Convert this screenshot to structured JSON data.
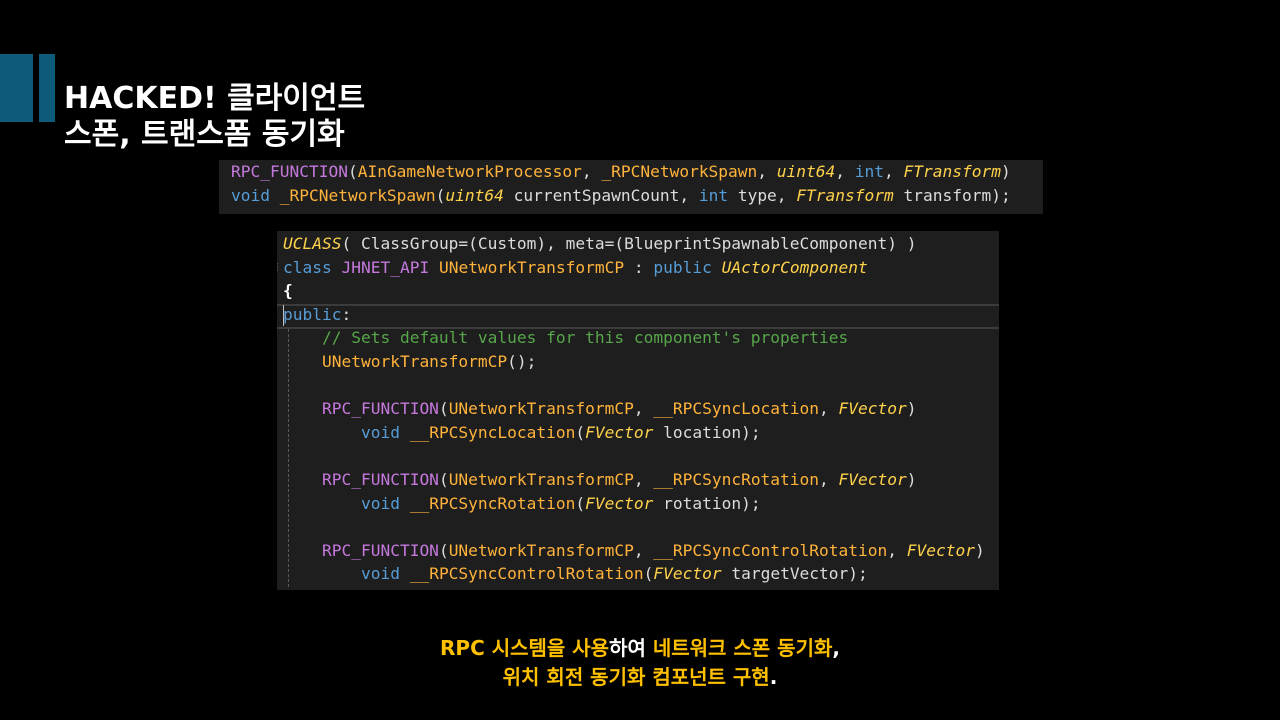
{
  "slide": {
    "title_line_1": "HACKED! 클라이언트",
    "title_line_2": "스폰, 트랜스폼 동기화"
  },
  "code_rpc": {
    "lines": [
      [
        {
          "t": "RPC_FUNCTION",
          "c": "macro"
        },
        {
          "t": "(",
          "c": "plain"
        },
        {
          "t": "AInGameNetworkProcessor",
          "c": "fn"
        },
        {
          "t": ", ",
          "c": "plain"
        },
        {
          "t": "_RPCNetworkSpawn",
          "c": "fn"
        },
        {
          "t": ", ",
          "c": "plain"
        },
        {
          "t": "uint64",
          "c": "type"
        },
        {
          "t": ", ",
          "c": "plain"
        },
        {
          "t": "int",
          "c": "kw"
        },
        {
          "t": ", ",
          "c": "plain"
        },
        {
          "t": "FTransform",
          "c": "type"
        },
        {
          "t": ")",
          "c": "plain"
        }
      ],
      [
        {
          "t": "void",
          "c": "kw"
        },
        {
          "t": " ",
          "c": "plain"
        },
        {
          "t": "_RPCNetworkSpawn",
          "c": "fn"
        },
        {
          "t": "(",
          "c": "plain"
        },
        {
          "t": "uint64",
          "c": "type"
        },
        {
          "t": " currentSpawnCount, ",
          "c": "plain"
        },
        {
          "t": "int",
          "c": "kw"
        },
        {
          "t": " type, ",
          "c": "plain"
        },
        {
          "t": "FTransform",
          "c": "type"
        },
        {
          "t": " transform);",
          "c": "plain"
        }
      ]
    ]
  },
  "code_class": {
    "lines": [
      [
        {
          "t": "UCLASS",
          "c": "type"
        },
        {
          "t": "( ClassGroup=(Custom), meta=(BlueprintSpawnableComponent) )",
          "c": "plain"
        }
      ],
      [
        {
          "t": "class",
          "c": "kw"
        },
        {
          "t": " ",
          "c": "plain"
        },
        {
          "t": "JHNET_API",
          "c": "macro"
        },
        {
          "t": " ",
          "c": "plain"
        },
        {
          "t": "UNetworkTransformCP",
          "c": "fn"
        },
        {
          "t": " : ",
          "c": "plain"
        },
        {
          "t": "public",
          "c": "kw"
        },
        {
          "t": " ",
          "c": "plain"
        },
        {
          "t": "UActorComponent",
          "c": "type"
        }
      ],
      [
        {
          "t": "{",
          "c": "bracket"
        }
      ],
      [
        {
          "t": "public",
          "c": "kw"
        },
        {
          "t": ":",
          "c": "plain"
        }
      ],
      [
        {
          "t": "    ",
          "c": "plain"
        },
        {
          "t": "// Sets default values for this component's properties",
          "c": "comment"
        }
      ],
      [
        {
          "t": "    ",
          "c": "plain"
        },
        {
          "t": "UNetworkTransformCP",
          "c": "fn"
        },
        {
          "t": "();",
          "c": "plain"
        }
      ],
      [],
      [
        {
          "t": "    ",
          "c": "plain"
        },
        {
          "t": "RPC_FUNCTION",
          "c": "macro"
        },
        {
          "t": "(",
          "c": "plain"
        },
        {
          "t": "UNetworkTransformCP",
          "c": "fn"
        },
        {
          "t": ", ",
          "c": "plain"
        },
        {
          "t": "__RPCSyncLocation",
          "c": "fn"
        },
        {
          "t": ", ",
          "c": "plain"
        },
        {
          "t": "FVector",
          "c": "type"
        },
        {
          "t": ")",
          "c": "plain"
        }
      ],
      [
        {
          "t": "        ",
          "c": "plain"
        },
        {
          "t": "void",
          "c": "kw"
        },
        {
          "t": " ",
          "c": "plain"
        },
        {
          "t": "__RPCSyncLocation",
          "c": "fn"
        },
        {
          "t": "(",
          "c": "plain"
        },
        {
          "t": "FVector",
          "c": "type"
        },
        {
          "t": " location);",
          "c": "plain"
        }
      ],
      [],
      [
        {
          "t": "    ",
          "c": "plain"
        },
        {
          "t": "RPC_FUNCTION",
          "c": "macro"
        },
        {
          "t": "(",
          "c": "plain"
        },
        {
          "t": "UNetworkTransformCP",
          "c": "fn"
        },
        {
          "t": ", ",
          "c": "plain"
        },
        {
          "t": "__RPCSyncRotation",
          "c": "fn"
        },
        {
          "t": ", ",
          "c": "plain"
        },
        {
          "t": "FVector",
          "c": "type"
        },
        {
          "t": ")",
          "c": "plain"
        }
      ],
      [
        {
          "t": "        ",
          "c": "plain"
        },
        {
          "t": "void",
          "c": "kw"
        },
        {
          "t": " ",
          "c": "plain"
        },
        {
          "t": "__RPCSyncRotation",
          "c": "fn"
        },
        {
          "t": "(",
          "c": "plain"
        },
        {
          "t": "FVector",
          "c": "type"
        },
        {
          "t": " rotation);",
          "c": "plain"
        }
      ],
      [],
      [
        {
          "t": "    ",
          "c": "plain"
        },
        {
          "t": "RPC_FUNCTION",
          "c": "macro"
        },
        {
          "t": "(",
          "c": "plain"
        },
        {
          "t": "UNetworkTransformCP",
          "c": "fn"
        },
        {
          "t": ", ",
          "c": "plain"
        },
        {
          "t": "__RPCSyncControlRotation",
          "c": "fn"
        },
        {
          "t": ", ",
          "c": "plain"
        },
        {
          "t": "FVector",
          "c": "type"
        },
        {
          "t": ")",
          "c": "plain"
        }
      ],
      [
        {
          "t": "        ",
          "c": "plain"
        },
        {
          "t": "void",
          "c": "kw"
        },
        {
          "t": " ",
          "c": "plain"
        },
        {
          "t": "__RPCSyncControlRotation",
          "c": "fn"
        },
        {
          "t": "(",
          "c": "plain"
        },
        {
          "t": "FVector",
          "c": "type"
        },
        {
          "t": " targetVector);",
          "c": "plain"
        }
      ]
    ]
  },
  "caption": {
    "line_1": [
      {
        "t": "RPC 시스템을 사용",
        "c": "cap-y"
      },
      {
        "t": "하여 ",
        "c": "cap-w"
      },
      {
        "t": "네트워크 스폰 동기화",
        "c": "cap-y"
      },
      {
        "t": ",",
        "c": "cap-w"
      }
    ],
    "line_2": [
      {
        "t": "위치 회전 동기화 컴포넌트 구현",
        "c": "cap-y"
      },
      {
        "t": ".",
        "c": "cap-w"
      }
    ]
  },
  "colors": {
    "background": "#000000",
    "accent_bar": "#0e5a7a",
    "code_background": "#1e1e1e",
    "keyword": "#569cd6",
    "macro": "#c679dd",
    "function": "#ffb33b",
    "type": "#ffd24c",
    "comment": "#57a64a",
    "caption_highlight": "#ffc000"
  }
}
